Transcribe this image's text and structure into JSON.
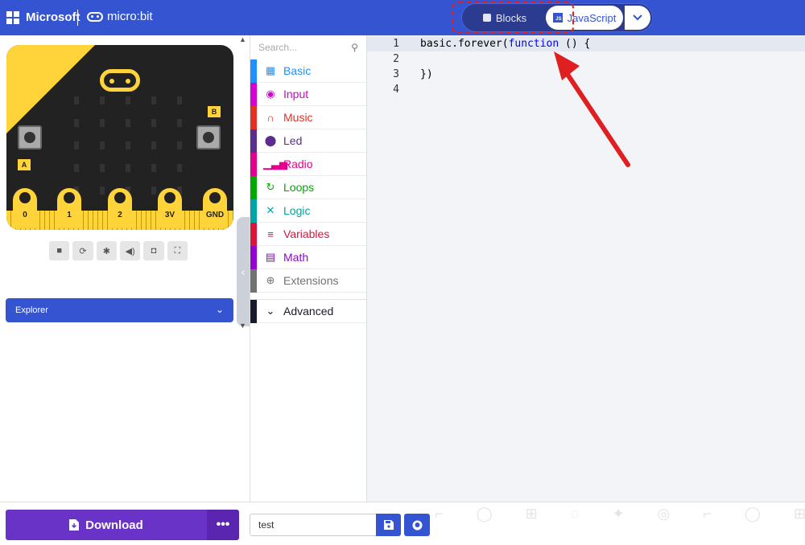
{
  "header": {
    "brand": "Microsoft",
    "product": "micro:bit",
    "toggle": {
      "blocks_label": "Blocks",
      "js_label": "JavaScript",
      "js_badge": "JS"
    }
  },
  "simulator": {
    "pins": [
      "0",
      "1",
      "2",
      "3V",
      "GND"
    ],
    "button_a": "A",
    "button_b": "B",
    "toolbar": [
      "stop-icon",
      "restart-icon",
      "debug-icon",
      "mute-icon",
      "screenshot-icon",
      "fullscreen-icon"
    ]
  },
  "explorer": {
    "label": "Explorer"
  },
  "toolbox": {
    "search_placeholder": "Search...",
    "categories": [
      {
        "name": "Basic",
        "color": "#1e90ff",
        "icon": "grid-icon"
      },
      {
        "name": "Input",
        "color": "#d400d4",
        "icon": "input-icon"
      },
      {
        "name": "Music",
        "color": "#e63022",
        "icon": "headphones-icon"
      },
      {
        "name": "Led",
        "color": "#5c2d91",
        "icon": "toggle-icon"
      },
      {
        "name": "Radio",
        "color": "#e3008c",
        "icon": "signal-icon"
      },
      {
        "name": "Loops",
        "color": "#00aa00",
        "icon": "loop-icon"
      },
      {
        "name": "Logic",
        "color": "#00a4a6",
        "icon": "shuffle-icon"
      },
      {
        "name": "Variables",
        "color": "#dc143c",
        "icon": "list-icon"
      },
      {
        "name": "Math",
        "color": "#9400d3",
        "icon": "calculator-icon"
      },
      {
        "name": "Extensions",
        "color": "#717171",
        "icon": "plus-circle-icon"
      }
    ],
    "advanced": "Advanced"
  },
  "editor": {
    "lines": [
      {
        "num": "1",
        "pre": "basic.forever(",
        "kw": "function",
        "post": " () {"
      },
      {
        "num": "2",
        "pre": "",
        "kw": "",
        "post": ""
      },
      {
        "num": "3",
        "pre": "})",
        "kw": "",
        "post": ""
      },
      {
        "num": "4",
        "pre": "",
        "kw": "",
        "post": ""
      }
    ]
  },
  "footer": {
    "download_label": "Download",
    "more_label": "•••",
    "project_name": "test"
  },
  "colors": {
    "header": "#3454d1",
    "download": "#6a33c8",
    "annotation": "#e02020"
  }
}
